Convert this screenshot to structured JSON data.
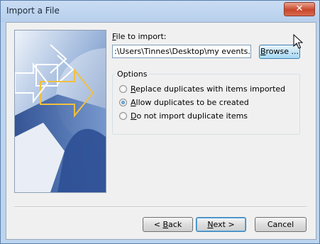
{
  "window": {
    "title": "Import a File",
    "close_glyph": "✕"
  },
  "file": {
    "label_mnemonic": "F",
    "label_rest": "ile to import:",
    "value": ":\\Users\\Tinnes\\Desktop\\my events.csv"
  },
  "browse": {
    "mnemonic": "B",
    "rest": "rowse ..."
  },
  "options": {
    "title": "Options",
    "items": [
      {
        "mnemonic": "R",
        "rest": "eplace duplicates with items imported",
        "checked": false
      },
      {
        "mnemonic": "A",
        "rest": "llow duplicates to be created",
        "checked": true
      },
      {
        "mnemonic": "D",
        "rest": "o not import duplicate items",
        "checked": false
      }
    ]
  },
  "footer": {
    "back_prefix": "< ",
    "back_mnemonic": "B",
    "back_rest": "ack",
    "next_mnemonic": "N",
    "next_rest": "ext >",
    "cancel": "Cancel"
  },
  "icons": {
    "banner": "import-wizard-banner",
    "cursor": "mouse-pointer-icon"
  }
}
